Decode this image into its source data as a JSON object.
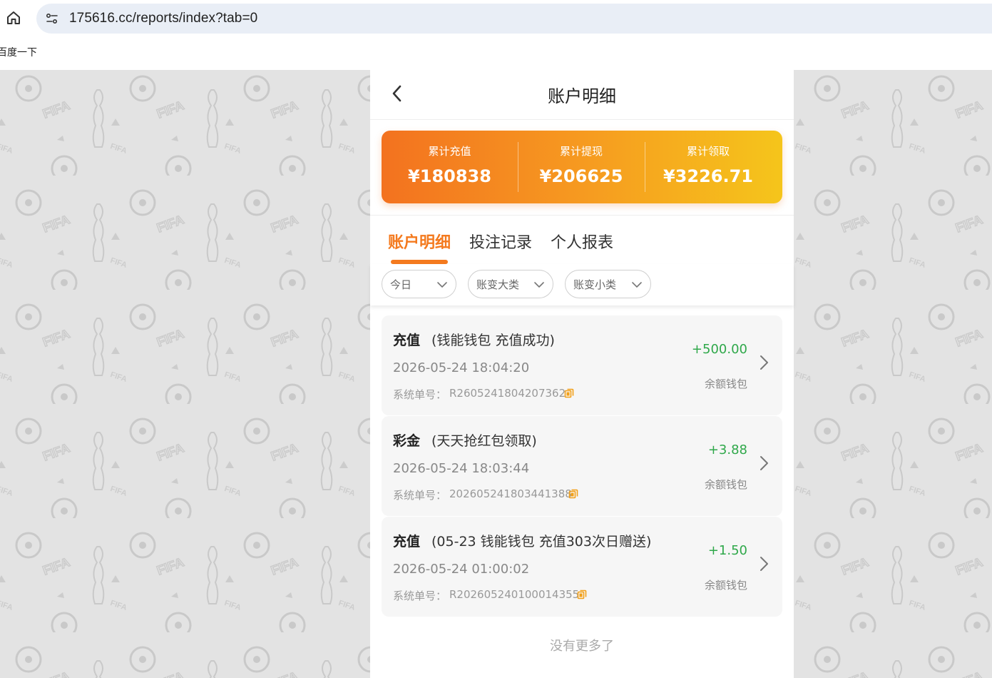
{
  "browser": {
    "url": "175616.cc/reports/index?tab=0",
    "bookmark": "百度一下"
  },
  "header": {
    "title": "账户明细"
  },
  "summary": {
    "items": [
      {
        "label": "累计充值",
        "value": "¥180838"
      },
      {
        "label": "累计提现",
        "value": "¥206625"
      },
      {
        "label": "累计领取",
        "value": "¥3226.71"
      }
    ]
  },
  "tabs": [
    {
      "label": "账户明细",
      "active": true
    },
    {
      "label": "投注记录",
      "active": false
    },
    {
      "label": "个人报表",
      "active": false
    }
  ],
  "filters": [
    {
      "label": "今日"
    },
    {
      "label": "账变大类"
    },
    {
      "label": "账变小类"
    }
  ],
  "records": [
    {
      "type": "充值",
      "desc": "(钱能钱包 充值成功)",
      "time": "2026-05-24 18:04:20",
      "order_label": "系统单号：",
      "order": "R2605241804207362",
      "amount": "+500.00",
      "wallet": "余额钱包"
    },
    {
      "type": "彩金",
      "desc": "(天天抢红包领取)",
      "time": "2026-05-24 18:03:44",
      "order_label": "系统单号：",
      "order": "202605241803441388",
      "amount": "+3.88",
      "wallet": "余额钱包"
    },
    {
      "type": "充值",
      "desc": "(05-23 钱能钱包 充值303次日赠送)",
      "time": "2026-05-24 01:00:02",
      "order_label": "系统单号：",
      "order": "R202605240100014355",
      "amount": "+1.50",
      "wallet": "余额钱包"
    }
  ],
  "footer": {
    "no_more": "没有更多了"
  },
  "colors": {
    "accent": "#f47a1e",
    "amount_positive": "#2fa84a",
    "gradient_start": "#f3721f",
    "gradient_end": "#f5c51b"
  },
  "icons": [
    "home-icon",
    "site-settings-icon",
    "back-arrow-icon",
    "chevron-down-icon",
    "copy-icon",
    "chevron-right-icon"
  ]
}
